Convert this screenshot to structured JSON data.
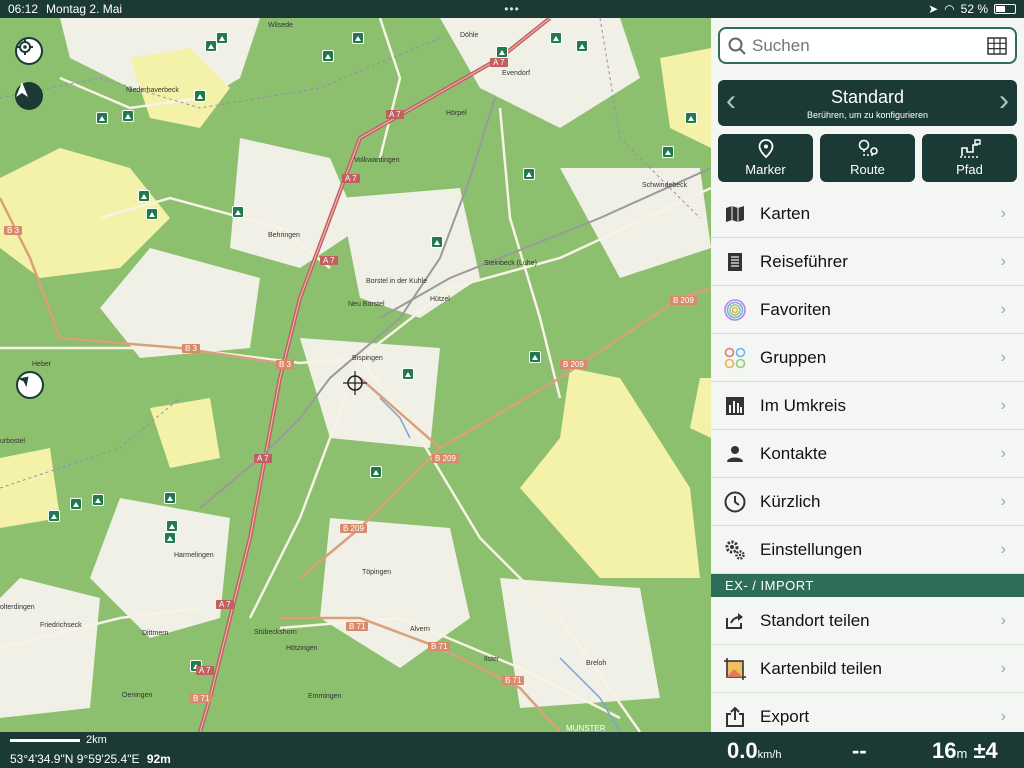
{
  "status_bar": {
    "time": "06:12",
    "date": "Montag 2. Mai",
    "dots": "•••",
    "battery_text": "52 %",
    "battery_level": 0.52
  },
  "map": {
    "places": [
      "Wilsede",
      "Döhle",
      "Evendorf",
      "Niederhaverbeck",
      "Hörpel",
      "Volkwardingen",
      "Schwindebeck",
      "Behringen",
      "Steinbeck (Luhe)",
      "Borstel in der Kuhle",
      "Neu Borstel",
      "Hützel",
      "Bispingen",
      "Heber",
      "urbostel",
      "Harmelingen",
      "Töpingen",
      "olterdingen",
      "Friedrichseck",
      "Dittmern",
      "Stübeckshorn",
      "Hötzingen",
      "Alvern",
      "Ilster",
      "Breloh",
      "Oeningen",
      "Emmingen",
      "MUNSTER"
    ],
    "shields": [
      "A 7",
      "B 3",
      "B 209",
      "B 71"
    ]
  },
  "panel": {
    "search_placeholder": "Suchen",
    "profile_title": "Standard",
    "profile_subtitle": "Berühren, um zu konfigurieren",
    "tools": [
      {
        "label": "Marker",
        "icon": "marker-pin-icon"
      },
      {
        "label": "Route",
        "icon": "route-icon"
      },
      {
        "label": "Pfad",
        "icon": "track-icon"
      }
    ],
    "menu": [
      {
        "label": "Karten",
        "icon": "map-icon"
      },
      {
        "label": "Reiseführer",
        "icon": "guide-icon"
      },
      {
        "label": "Favoriten",
        "icon": "favorites-icon"
      },
      {
        "label": "Gruppen",
        "icon": "groups-icon"
      },
      {
        "label": "Im Umkreis",
        "icon": "nearby-icon"
      },
      {
        "label": "Kontakte",
        "icon": "contacts-icon"
      },
      {
        "label": "Kürzlich",
        "icon": "clock-icon"
      },
      {
        "label": "Einstellungen",
        "icon": "settings-icon"
      }
    ],
    "section_header": "EX- / IMPORT",
    "import_menu": [
      {
        "label": "Standort teilen",
        "icon": "share-location-icon"
      },
      {
        "label": "Kartenbild teilen",
        "icon": "share-map-image-icon"
      },
      {
        "label": "Export",
        "icon": "export-icon"
      }
    ]
  },
  "bottom": {
    "scale": "2km",
    "coordinates": "53°4'34.9\"N 9°59'25.4\"E",
    "altitude": "92m",
    "speed_value": "0.0",
    "speed_unit": "km/h",
    "heading": "--",
    "accuracy_value": "16",
    "accuracy_unit": "m",
    "accuracy_delta": "±4"
  },
  "colors": {
    "dark": "#1b3a36",
    "accent": "#2f6d5b",
    "forest": "#8cbf6e",
    "heath": "#f3f2a8",
    "motorway": "#c06060"
  }
}
